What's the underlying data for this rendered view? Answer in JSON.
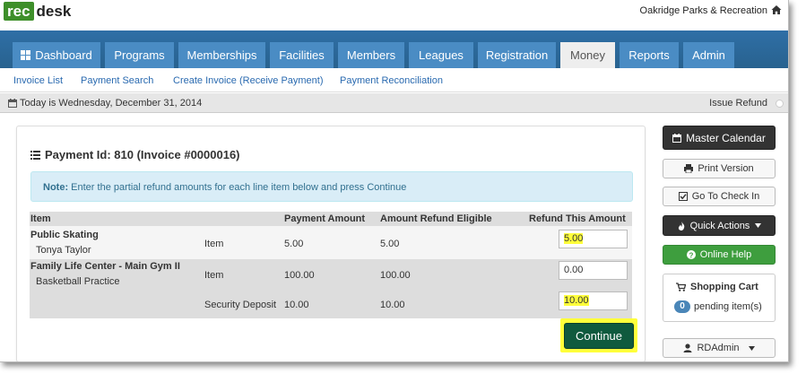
{
  "brand": {
    "logo_part1": "rec",
    "logo_part2": "desk",
    "org_name": "Oakridge Parks & Recreation"
  },
  "nav": {
    "tabs": [
      {
        "label": "Dashboard",
        "active": false
      },
      {
        "label": "Programs",
        "active": false
      },
      {
        "label": "Memberships",
        "active": false
      },
      {
        "label": "Facilities",
        "active": false
      },
      {
        "label": "Members",
        "active": false
      },
      {
        "label": "Leagues",
        "active": false
      },
      {
        "label": "Registration",
        "active": false
      },
      {
        "label": "Money",
        "active": true
      },
      {
        "label": "Reports",
        "active": false
      },
      {
        "label": "Admin",
        "active": false
      }
    ]
  },
  "subnav": {
    "links": [
      "Invoice List",
      "Payment Search",
      "Create Invoice (Receive Payment)",
      "Payment Reconciliation"
    ]
  },
  "datebar": {
    "date_text": "Today is Wednesday, December 31, 2014",
    "issue_refund": "Issue Refund"
  },
  "panel": {
    "title": "Payment Id: 810 (Invoice #0000016)",
    "note_label": "Note:",
    "note_text": "Enter the partial refund amounts for each line item below and press Continue",
    "columns": {
      "item": "Item",
      "payment_amount": "Payment Amount",
      "refund_eligible": "Amount Refund Eligible",
      "refund_this": "Refund This Amount"
    },
    "rows": [
      {
        "name": "Public Skating",
        "sub": "Tonya Taylor",
        "type": "Item",
        "payment": "5.00",
        "eligible": "5.00",
        "refund": "5.00"
      },
      {
        "name": "Family Life Center - Main Gym II",
        "sub": "Basketball Practice",
        "type": "Item",
        "payment": "100.00",
        "eligible": "100.00",
        "refund": "0.00"
      },
      {
        "name": "",
        "sub": "",
        "type": "Security Deposit",
        "payment": "10.00",
        "eligible": "10.00",
        "refund": "10.00"
      }
    ],
    "continue_label": "Continue"
  },
  "sidebar": {
    "master_calendar": "Master Calendar",
    "print_version": "Print Version",
    "go_to_check_in": "Go To Check In",
    "quick_actions": "Quick Actions",
    "online_help": "Online Help",
    "cart_title": "Shopping Cart",
    "cart_count": "0",
    "cart_pending": "pending item(s)",
    "user": "RDAdmin"
  },
  "colors": {
    "nav_bg": "#2a6496",
    "tab_bg": "#4a8cc4",
    "highlight": "#ffff3a",
    "continue_bg": "#0f5a3e",
    "help_bg": "#3e9e3e"
  },
  "icons": [
    "home-icon",
    "dashboard-icon",
    "calendar-icon",
    "list-icon",
    "print-icon",
    "check-in-icon",
    "fire-icon",
    "help-icon",
    "cart-icon",
    "user-icon",
    "caret-down-icon"
  ]
}
